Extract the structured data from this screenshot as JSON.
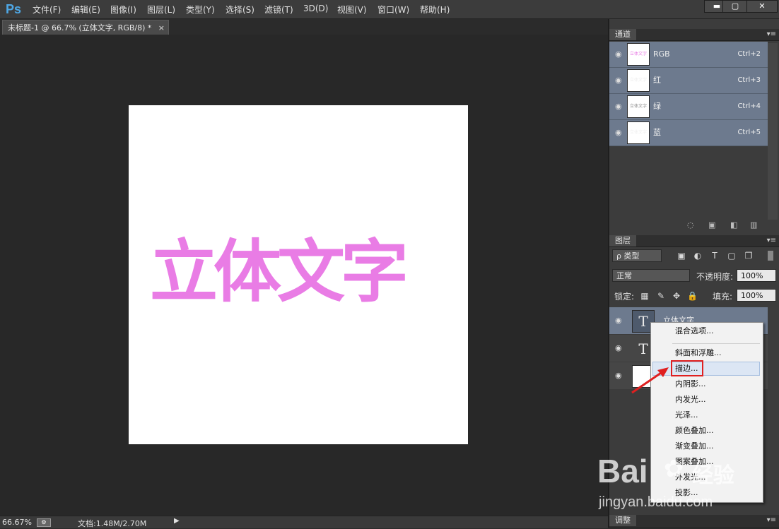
{
  "app": {
    "logo": "Ps"
  },
  "menu": [
    "文件(F)",
    "编辑(E)",
    "图像(I)",
    "图层(L)",
    "类型(Y)",
    "选择(S)",
    "滤镜(T)",
    "3D(D)",
    "视图(V)",
    "窗口(W)",
    "帮助(H)"
  ],
  "window_controls": {
    "minimize": "▬",
    "maximize": "▢",
    "close": "✕"
  },
  "document_tab": {
    "title": "未标题-1 @ 66.7% (立体文字, RGB/8) *",
    "close": "×"
  },
  "canvas": {
    "text": "立体文字",
    "text_color": "#e97ce5"
  },
  "status": {
    "zoom": "66.67%",
    "doc_info": "文档:1.48M/2.70M"
  },
  "channels_panel": {
    "tab": "通道",
    "rows": [
      {
        "name": "RGB",
        "shortcut": "Ctrl+2",
        "thumb_text": "立体文字"
      },
      {
        "name": "红",
        "shortcut": "Ctrl+3",
        "thumb_text": "立体文字"
      },
      {
        "name": "绿",
        "shortcut": "Ctrl+4",
        "thumb_text": "立体文字"
      },
      {
        "name": "蓝",
        "shortcut": "Ctrl+5",
        "thumb_text": "立体文字"
      }
    ]
  },
  "layers_panel": {
    "tab": "图层",
    "filter_kind": "ρ 类型",
    "blend_mode": "正常",
    "opacity_label": "不透明度:",
    "opacity_value": "100%",
    "lock_label": "锁定:",
    "fill_label": "填充:",
    "fill_value": "100%",
    "layers": [
      {
        "name": "立体文字",
        "thumb": "T"
      },
      {
        "name": "",
        "thumb": "T"
      },
      {
        "name": "",
        "thumb": ""
      }
    ]
  },
  "context_menu": {
    "items": [
      "混合选项...",
      "斜面和浮雕...",
      "描边...",
      "内阴影...",
      "内发光...",
      "光泽...",
      "颜色叠加...",
      "渐变叠加...",
      "图案叠加...",
      "外发光...",
      "投影..."
    ],
    "highlighted": "描边..."
  },
  "adjust_panel": {
    "tab": "调整"
  },
  "watermark": {
    "brand": "Bai",
    "brand2": "经验",
    "url": "jingyan.baidu.com"
  }
}
